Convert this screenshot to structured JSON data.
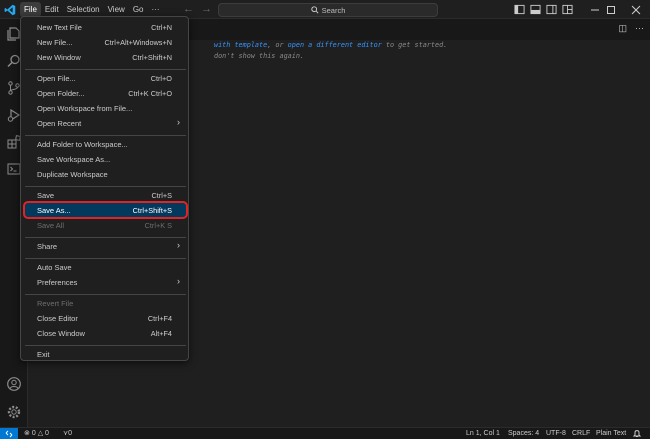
{
  "titlebar": {
    "menus": [
      "File",
      "Edit",
      "Selection",
      "View",
      "Go",
      "···"
    ],
    "search_label": "Search"
  },
  "editor": {
    "hint_line1_link1": "with template",
    "hint_line1_mid": ", or ",
    "hint_line1_link2": "open a different editor",
    "hint_line1_end": " to get started.",
    "hint_line2_link": "don't show",
    "hint_line2_end": " this again."
  },
  "file_menu": {
    "new_text_file": {
      "label": "New Text File",
      "key": "Ctrl+N"
    },
    "new_file": {
      "label": "New File...",
      "key": "Ctrl+Alt+Windows+N"
    },
    "new_window": {
      "label": "New Window",
      "key": "Ctrl+Shift+N"
    },
    "open_file": {
      "label": "Open File...",
      "key": "Ctrl+O"
    },
    "open_folder": {
      "label": "Open Folder...",
      "key": "Ctrl+K Ctrl+O"
    },
    "open_workspace": {
      "label": "Open Workspace from File..."
    },
    "open_recent": {
      "label": "Open Recent"
    },
    "add_folder": {
      "label": "Add Folder to Workspace..."
    },
    "save_workspace_as": {
      "label": "Save Workspace As..."
    },
    "duplicate_workspace": {
      "label": "Duplicate Workspace"
    },
    "save": {
      "label": "Save",
      "key": "Ctrl+S"
    },
    "save_as": {
      "label": "Save As...",
      "key": "Ctrl+Shift+S"
    },
    "save_all": {
      "label": "Save All",
      "key": "Ctrl+K S"
    },
    "share": {
      "label": "Share"
    },
    "auto_save": {
      "label": "Auto Save"
    },
    "preferences": {
      "label": "Preferences"
    },
    "revert_file": {
      "label": "Revert File"
    },
    "close_editor": {
      "label": "Close Editor",
      "key": "Ctrl+F4"
    },
    "close_window": {
      "label": "Close Window",
      "key": "Alt+F4"
    },
    "exit": {
      "label": "Exit"
    }
  },
  "statusbar": {
    "errors": "0",
    "warnings": "0",
    "ports": "0",
    "position": "Ln 1, Col 1",
    "spaces": "Spaces: 4",
    "encoding": "UTF-8",
    "eol": "CRLF",
    "language": "Plain Text"
  },
  "colors": {
    "accent": "#0078d4",
    "selection": "#04395e",
    "highlight_outline": "#e02424",
    "link": "#3794ff"
  }
}
